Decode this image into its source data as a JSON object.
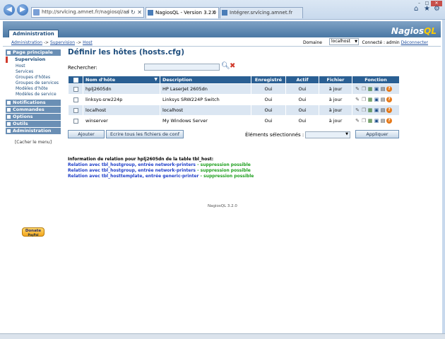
{
  "browser": {
    "address": "http://srvlcing.amnet.fr/nagiosql/ad",
    "tabs": [
      {
        "label": "NagiosQL - Version 3.2.0"
      },
      {
        "label": "Intégrer.srvlcing.amnet.fr"
      }
    ],
    "win_controls": [
      "–",
      "□",
      "✕"
    ]
  },
  "header": {
    "admin_tab": "Administration",
    "logo_main": "Nagios",
    "logo_ql": "QL"
  },
  "subbar": {
    "breadcrumb": [
      "Administration",
      "Supervision",
      "Host"
    ],
    "breadcrumb_sep": "->",
    "domain_label": "Domaine",
    "domain_value": "localhost",
    "connected_prefix": "Connecté : admin",
    "logout": "Déconnecter"
  },
  "sidebar": {
    "heads": [
      {
        "label": "Page principale"
      },
      {
        "label": "Supervision"
      },
      {
        "label": "Notifications"
      },
      {
        "label": "Commandes"
      },
      {
        "label": "Options"
      },
      {
        "label": "Outils"
      },
      {
        "label": "Administration"
      }
    ],
    "supervision_items": [
      "Host",
      "Services",
      "Groupes d'hôtes",
      "Groupes de services",
      "Modèles d'hôte",
      "Modèles de service"
    ],
    "hide_menu": "[Cacher le menu]",
    "donate_top": "Donate",
    "donate_bottom": "PayPal"
  },
  "main": {
    "title": "Définir les hôtes (hosts.cfg)",
    "search_label": "Rechercher:",
    "columns": [
      "Nom d'hôte",
      "Description",
      "Enregistré",
      "Actif",
      "Fichier",
      "Fonction"
    ],
    "rows": [
      {
        "name": "hplj2605dn",
        "description": "HP LaserJet 2605dn",
        "registered": "Oui",
        "active": "Oui",
        "file": "à jour"
      },
      {
        "name": "linksys-srw224p",
        "description": "Linksys SRW224P Switch",
        "registered": "Oui",
        "active": "Oui",
        "file": "à jour"
      },
      {
        "name": "localhost",
        "description": "localhost",
        "registered": "Oui",
        "active": "Oui",
        "file": "à jour"
      },
      {
        "name": "winserver",
        "description": "My Windows Server",
        "registered": "Oui",
        "active": "Oui",
        "file": "à jour"
      }
    ],
    "add_label": "Ajouter",
    "write_label": "Ecrire tous les fichiers de conf",
    "selected_label": "Éléments sélectionnés :",
    "apply_label": "Appliquer",
    "relation_title": "Information de relation pour hplj2605dn de la table tbl_host:",
    "relations": [
      {
        "text": "Relation avec tbl_hostgroup, entrée network-printers",
        "suffix": " - suppression possible"
      },
      {
        "text": "Relation avec tbl_hostgroup, entrée network-printers",
        "suffix": " - suppression possible"
      },
      {
        "text": "Relation avec tbl_hosttemplate, entrée generic-printer",
        "suffix": " - suppression possible"
      }
    ],
    "footer": "NagiosQL 3.2.0"
  }
}
